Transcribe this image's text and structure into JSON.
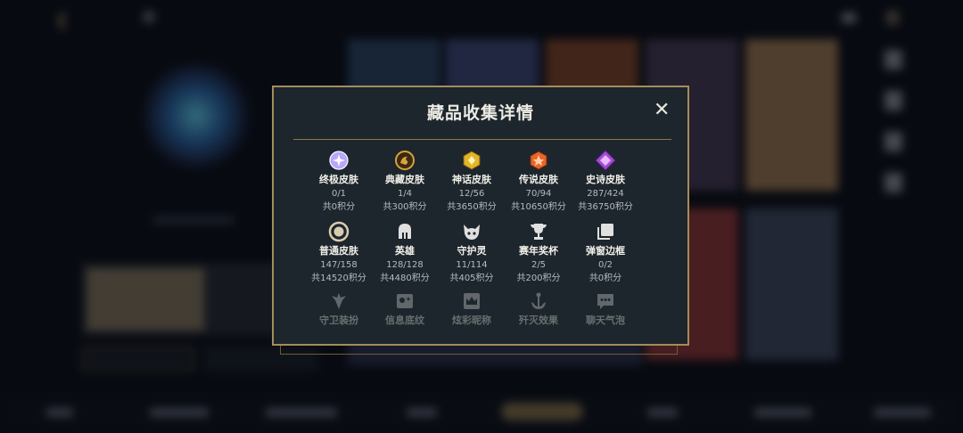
{
  "modal": {
    "title": "藏品收集详情",
    "close_glyph": "✕"
  },
  "items": [
    {
      "label": "终极皮肤",
      "count": "0/1",
      "points": "共0积分",
      "icon": "ultimate-skin-icon",
      "color": "#b8a6ff"
    },
    {
      "label": "典藏皮肤",
      "count": "1/4",
      "points": "共300积分",
      "icon": "prestige-skin-icon",
      "color": "#d9a23a"
    },
    {
      "label": "神话皮肤",
      "count": "12/56",
      "points": "共3650积分",
      "icon": "mythic-skin-icon",
      "color": "#e2b52a"
    },
    {
      "label": "传说皮肤",
      "count": "70/94",
      "points": "共10650积分",
      "icon": "legendary-skin-icon",
      "color": "#e8662a"
    },
    {
      "label": "史诗皮肤",
      "count": "287/424",
      "points": "共36750积分",
      "icon": "epic-skin-icon",
      "color": "#a34ad6"
    },
    {
      "label": "普通皮肤",
      "count": "147/158",
      "points": "共14520积分",
      "icon": "standard-skin-icon",
      "color": "#d8ccb0"
    },
    {
      "label": "英雄",
      "count": "128/128",
      "points": "共4480积分",
      "icon": "champion-helmet-icon",
      "color": "#e0e0e0"
    },
    {
      "label": "守护灵",
      "count": "11/114",
      "points": "共405积分",
      "icon": "little-legend-icon",
      "color": "#e0e0e0"
    },
    {
      "label": "赛年奖杯",
      "count": "2/5",
      "points": "共200积分",
      "icon": "trophy-icon",
      "color": "#e0e0e0"
    },
    {
      "label": "弹窗边框",
      "count": "0/2",
      "points": "共0积分",
      "icon": "frame-icon",
      "color": "#e0e0e0"
    },
    {
      "label": "守卫装扮",
      "count": "",
      "points": "",
      "icon": "ward-skin-icon",
      "color": "#e0e0e0"
    },
    {
      "label": "信息底纹",
      "count": "",
      "points": "",
      "icon": "banner-icon",
      "color": "#e0e0e0"
    },
    {
      "label": "炫彩昵称",
      "count": "",
      "points": "",
      "icon": "title-crown-icon",
      "color": "#e0e0e0"
    },
    {
      "label": "歼灭效果",
      "count": "",
      "points": "",
      "icon": "finisher-icon",
      "color": "#e0e0e0"
    },
    {
      "label": "聊天气泡",
      "count": "",
      "points": "",
      "icon": "chat-bubble-icon",
      "color": "#e0e0e0"
    }
  ],
  "colors": {
    "accent_gold": "#a38d5a",
    "modal_bg": "#1d262c"
  }
}
